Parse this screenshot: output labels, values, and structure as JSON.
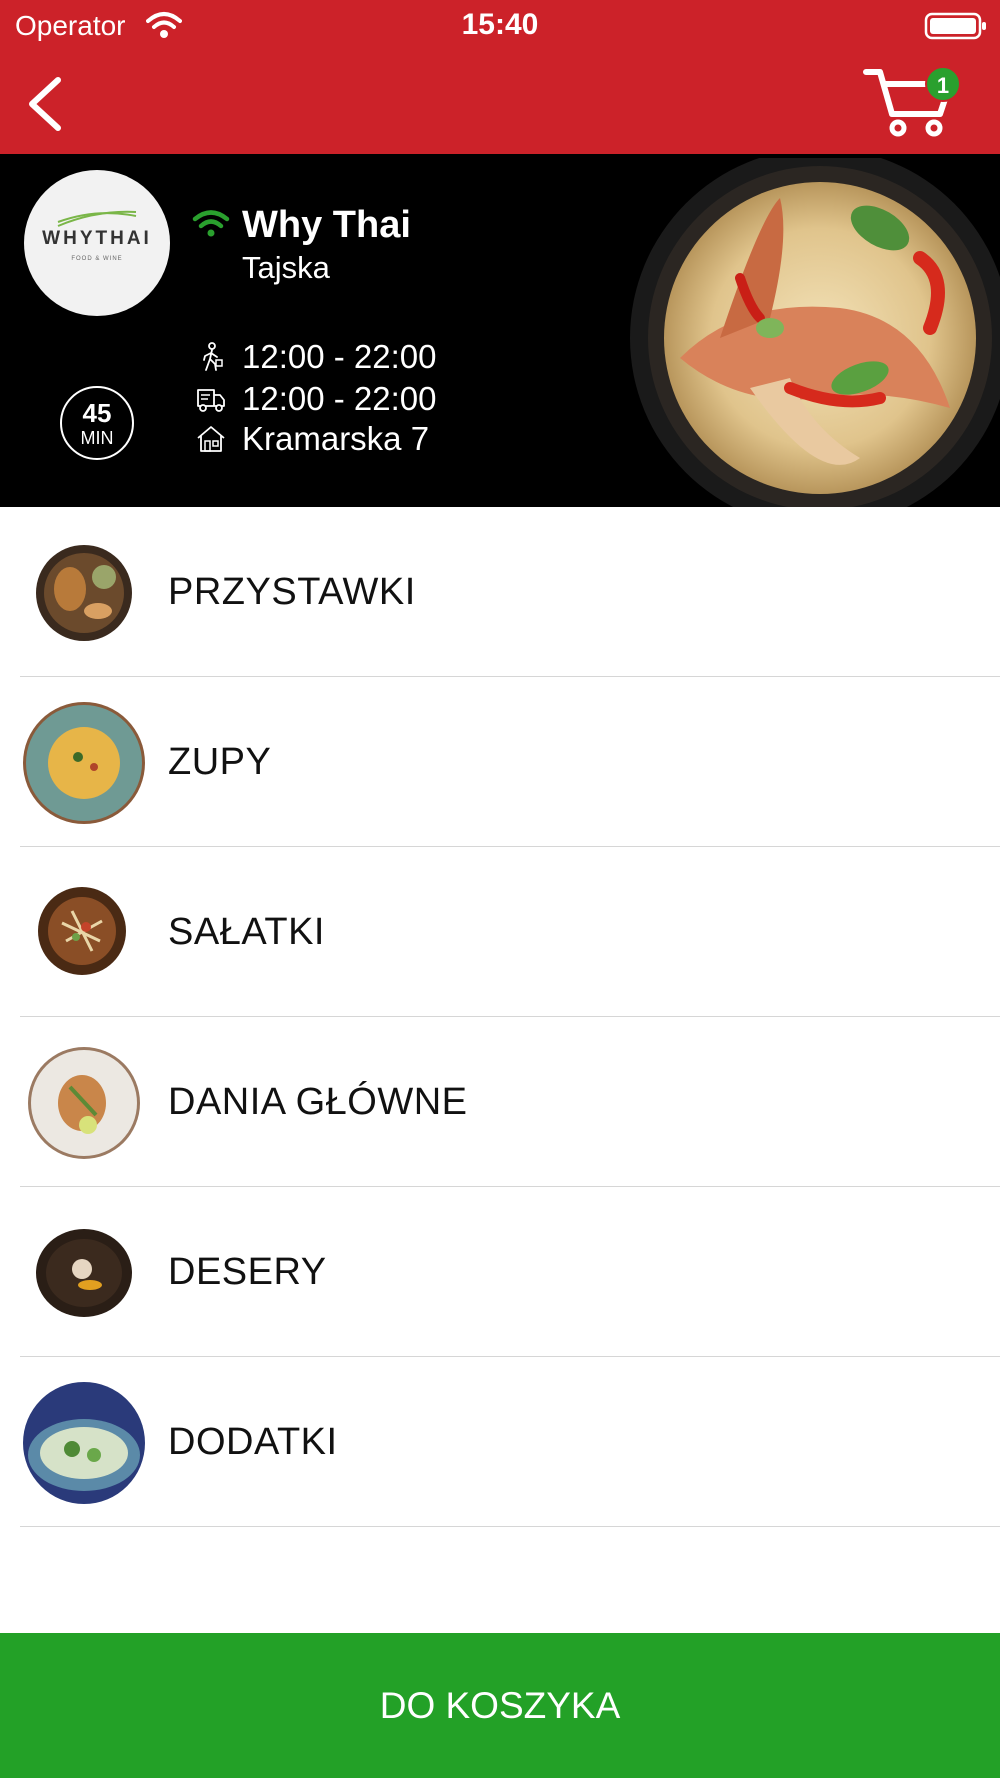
{
  "status_bar": {
    "carrier": "Operator",
    "time": "15:40"
  },
  "nav": {
    "cart_count": "1"
  },
  "restaurant": {
    "logo_text": "WHYTHAI",
    "logo_subtext": "FOOD & WINE",
    "name": "Why Thai",
    "cuisine": "Tajska",
    "delivery_time": "45",
    "delivery_time_unit": "MIN",
    "pickup_hours": "12:00 - 22:00",
    "delivery_hours": "12:00 - 22:00",
    "address": "Kramarska 7"
  },
  "categories": [
    {
      "label": "PRZYSTAWKI"
    },
    {
      "label": "ZUPY"
    },
    {
      "label": "SAŁATKI"
    },
    {
      "label": "DANIA GŁÓWNE"
    },
    {
      "label": "DESERY"
    },
    {
      "label": "DODATKI"
    }
  ],
  "footer": {
    "button_label": "DO KOSZYKA"
  },
  "colors": {
    "header_red": "#cc2229",
    "accent_green": "#23a127",
    "badge_green": "#2aa02e"
  }
}
